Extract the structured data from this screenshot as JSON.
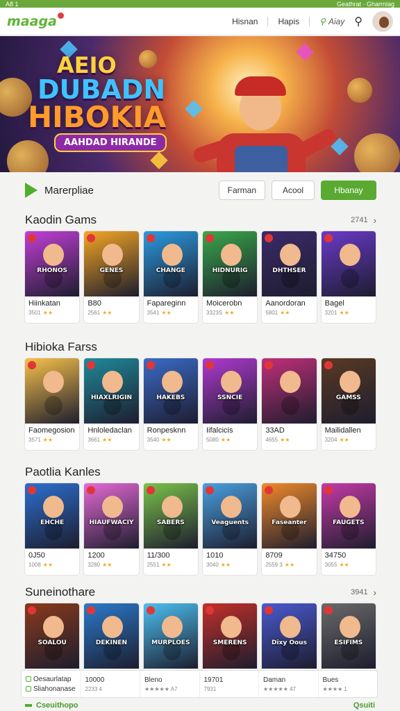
{
  "status": {
    "left": "A8 1",
    "right": "Geathrat · Gharrnlag"
  },
  "nav": {
    "logo": "maaga",
    "links": [
      "Hisnan",
      "Hapis"
    ],
    "search_label": "Aiay"
  },
  "hero": {
    "line1": "AEIO",
    "line2": "DUBADN",
    "line3": "HIBOKIA",
    "ribbon": "AAHDAD HIRANDE"
  },
  "market": {
    "title": "Marerpliae",
    "buttons": [
      "Farman",
      "Acool",
      "Hbanay"
    ]
  },
  "sections": [
    {
      "title": "Kaodin Gams",
      "count": "2741",
      "cards": [
        {
          "name": "Hiinkatan",
          "meta": "3501",
          "art": "RHONOS",
          "bg": "#c23fd8"
        },
        {
          "name": "B80",
          "meta": "2561",
          "art": "GENES",
          "bg": "#f5a623"
        },
        {
          "name": "Fapareginn",
          "meta": "3541",
          "art": "CHANGE",
          "bg": "#2b9be0"
        },
        {
          "name": "Moicerobn",
          "meta": "3323S",
          "art": "HIDNURIG",
          "bg": "#3aa84a"
        },
        {
          "name": "Aanordoran",
          "meta": "5801",
          "art": "DHTHSER",
          "bg": "#3b2a6a"
        },
        {
          "name": "Bagel",
          "meta": "3201",
          "art": "",
          "bg": "#6a3acb"
        }
      ]
    },
    {
      "title": "Hibioka Farss",
      "count": "",
      "cards": [
        {
          "name": "Faomegosion",
          "meta": "3571",
          "art": "",
          "bg": "#f7c24a"
        },
        {
          "name": "Hnloledaclan",
          "meta": "3661",
          "art": "HIAXLRIGIN",
          "bg": "#1f8a9a"
        },
        {
          "name": "Ronpesknn",
          "meta": "3540",
          "art": "HAKEBS",
          "bg": "#3b6bc8"
        },
        {
          "name": "Iifalcicis",
          "meta": "5080",
          "art": "SSNCIE",
          "bg": "#b03ad0"
        },
        {
          "name": "33AD",
          "meta": "4655",
          "art": "",
          "bg": "#c22f7a"
        },
        {
          "name": "Mailidallen",
          "meta": "3204",
          "art": "GAMSS",
          "bg": "#5a3a24"
        }
      ]
    },
    {
      "title": "Paotlia Kanles",
      "count": "",
      "cards": [
        {
          "name": "0J50",
          "meta": "1008",
          "art": "EHCHE",
          "bg": "#2c6fd0"
        },
        {
          "name": "1200",
          "meta": "3280",
          "art": "HIAUFWACIY",
          "bg": "#e56ad6"
        },
        {
          "name": "11/300",
          "meta": "2551",
          "art": "SABERS",
          "bg": "#7ac24a"
        },
        {
          "name": "1010",
          "meta": "3040",
          "art": "Veaguents",
          "bg": "#4aa0e0"
        },
        {
          "name": "8709",
          "meta": "2559 3",
          "art": "Faseanter",
          "bg": "#f08a2a"
        },
        {
          "name": "34750",
          "meta": "3055",
          "art": "FAUGETS",
          "bg": "#c63aa8"
        }
      ]
    },
    {
      "title": "Suneinothare",
      "count": "3941",
      "cards": [
        {
          "name": "",
          "meta": "",
          "art": "SOALOU",
          "bg": "#8a3a1c"
        },
        {
          "name": "",
          "meta": "",
          "art": "DEKINEN",
          "bg": "#2a7acb"
        },
        {
          "name": "",
          "meta": "",
          "art": "MURPLOES",
          "bg": "#4bc0f0"
        },
        {
          "name": "",
          "meta": "",
          "art": "SMERENS",
          "bg": "#c2302a"
        },
        {
          "name": "",
          "meta": "",
          "art": "Dixy Oous",
          "bg": "#4a5ad0"
        },
        {
          "name": "",
          "meta": "",
          "art": "ESIFIMS",
          "bg": "#6a6a6a"
        }
      ]
    }
  ],
  "bottom": {
    "col1": [
      "Oesaurlatap",
      "Sliahonanase"
    ],
    "col2": {
      "title": "10000",
      "sub": "2233 4"
    },
    "col3": {
      "title": "Bleno",
      "sub": "★★★★★ A7"
    },
    "col4": {
      "title": "19701",
      "sub": "7931"
    },
    "col5": {
      "title": "Daman",
      "sub": "★★★★★ 47"
    },
    "col6": {
      "title": "Bues",
      "sub": "★★★★ 1"
    }
  },
  "footer_peek": {
    "left": "Cseuithopo",
    "right": "Qsuiti"
  },
  "colors": {
    "accent": "#5aaa32",
    "status_bar": "#6aa83b"
  }
}
